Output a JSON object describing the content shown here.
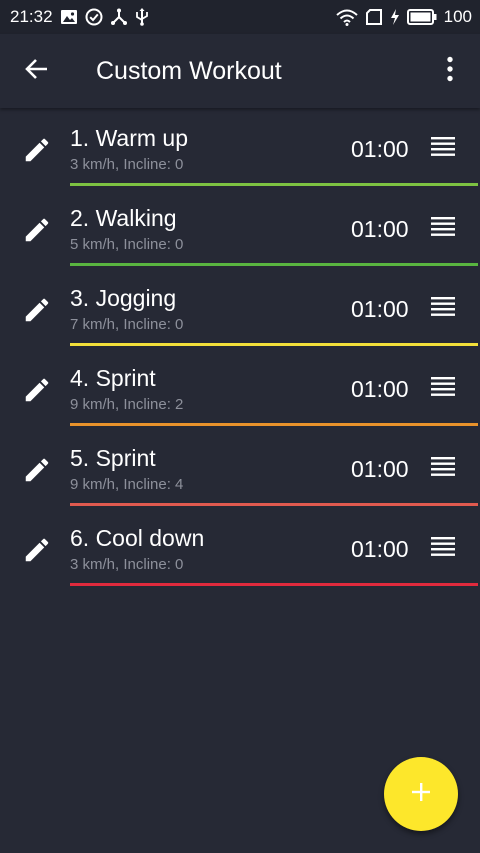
{
  "status_bar": {
    "time": "21:32",
    "battery_level": "100",
    "left_icons": [
      "image-icon",
      "check-circle-icon",
      "usb-tether-icon",
      "usb-icon"
    ],
    "right_icons": [
      "wifi-icon",
      "sim-icon",
      "charging-icon",
      "battery-icon"
    ]
  },
  "app_bar": {
    "title": "Custom Workout",
    "back_icon": "arrow-left-icon",
    "menu_icon": "more-vert-icon"
  },
  "steps": [
    {
      "name": "1. Warm up",
      "detail": "3 km/h, Incline: 0",
      "duration": "01:00",
      "color": "#7dc242"
    },
    {
      "name": "2. Walking",
      "detail": "5 km/h, Incline: 0",
      "duration": "01:00",
      "color": "#59b540"
    },
    {
      "name": "3. Jogging",
      "detail": "7 km/h, Incline: 0",
      "duration": "01:00",
      "color": "#f2df3a"
    },
    {
      "name": "4. Sprint",
      "detail": "9 km/h, Incline: 2",
      "duration": "01:00",
      "color": "#e8922b"
    },
    {
      "name": "5. Sprint",
      "detail": "9 km/h, Incline: 4",
      "duration": "01:00",
      "color": "#e05a4f"
    },
    {
      "name": "6. Cool down",
      "detail": "3 km/h, Incline: 0",
      "duration": "01:00",
      "color": "#e02a3d"
    }
  ],
  "fab": {
    "icon": "plus-icon",
    "color": "#fde72b"
  },
  "colors": {
    "background": "#262935",
    "status_bar": "#20232d",
    "secondary_text": "#8d909b"
  }
}
